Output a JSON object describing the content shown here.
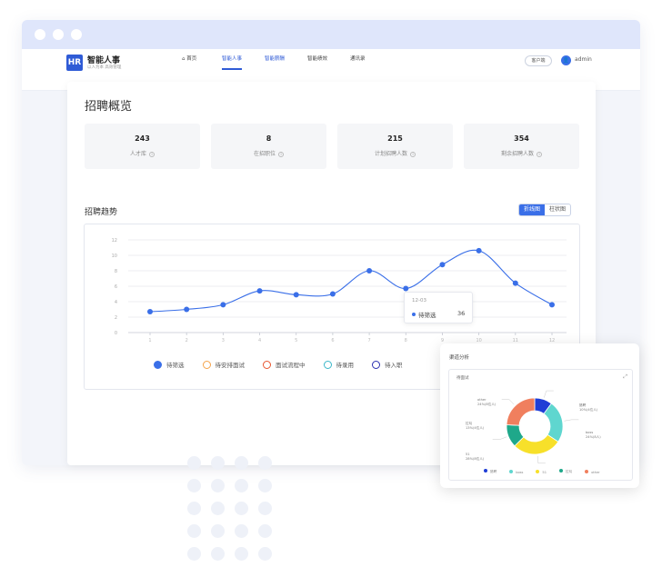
{
  "window": {
    "titlebar_dots": 3
  },
  "app": {
    "logo_text": "HR",
    "brand": "智能人事",
    "brand_sub": "以人为本 高效管理",
    "nav": [
      {
        "label": "首页",
        "active": false,
        "icon": "home-icon"
      },
      {
        "label": "智能人事",
        "active": true
      },
      {
        "label": "智能薪酬",
        "active": false,
        "color": "#2f5bd6"
      },
      {
        "label": "智能绩效",
        "active": false
      },
      {
        "label": "通讯录",
        "active": false
      }
    ],
    "client_button": "客户端",
    "user": "admin"
  },
  "overview": {
    "title": "招聘概览",
    "stats": [
      {
        "value": "243",
        "label": "人才库"
      },
      {
        "value": "8",
        "label": "在招职位"
      },
      {
        "value": "215",
        "label": "计划招聘人数"
      },
      {
        "value": "354",
        "label": "剩余招聘人数"
      }
    ]
  },
  "trend": {
    "title": "招聘趋势",
    "toggle": [
      "折线图",
      "柱状图"
    ],
    "toggle_active": 0,
    "tooltip": {
      "date": "12-03",
      "series": "待筛选",
      "value": "36"
    }
  },
  "chart_data": {
    "type": "line",
    "title": "招聘趋势",
    "x": [
      "1",
      "2",
      "3",
      "4",
      "5",
      "6",
      "7",
      "8",
      "9",
      "10",
      "11",
      "12"
    ],
    "ylim": [
      0,
      12
    ],
    "yticks": [
      0,
      2,
      4,
      6,
      8,
      10,
      12
    ],
    "grid": true,
    "legend_position": "bottom",
    "series": [
      {
        "name": "待筛选",
        "color": "#3a6fe8",
        "values": [
          2.7,
          3.0,
          3.6,
          5.4,
          4.9,
          5.0,
          8.0,
          5.7,
          8.8,
          10.6,
          6.4,
          3.6
        ]
      }
    ],
    "legend": [
      {
        "name": "待筛选",
        "color": "#3a6fe8",
        "filled": true
      },
      {
        "name": "待安排面试",
        "color": "#f5a34a",
        "filled": false
      },
      {
        "name": "面试流程中",
        "color": "#e8552e",
        "filled": false
      },
      {
        "name": "待录用",
        "color": "#3ab7c9",
        "filled": false
      },
      {
        "name": "待入职",
        "color": "#2a2fb0",
        "filled": false
      }
    ]
  },
  "channel": {
    "title": "渠道分析",
    "subtitle": "待面试",
    "slices": [
      {
        "name": "猎聘",
        "value": 10,
        "color": "#1f3ed6",
        "label": "猎聘\n10%(4位人)"
      },
      {
        "name": "boss",
        "value": 24,
        "color": "#5fd6cf",
        "label": "boss\n24%(8人)"
      },
      {
        "name": "51",
        "value": 28,
        "color": "#f7e02a",
        "label": "51\n28%(8位人)"
      },
      {
        "name": "拉勾",
        "value": 13,
        "color": "#1fa88a",
        "label": "拉勾\n13%(4位人)"
      },
      {
        "name": "other",
        "value": 24,
        "color": "#f07f5e",
        "label": "other\n24%(8位人)"
      }
    ]
  }
}
